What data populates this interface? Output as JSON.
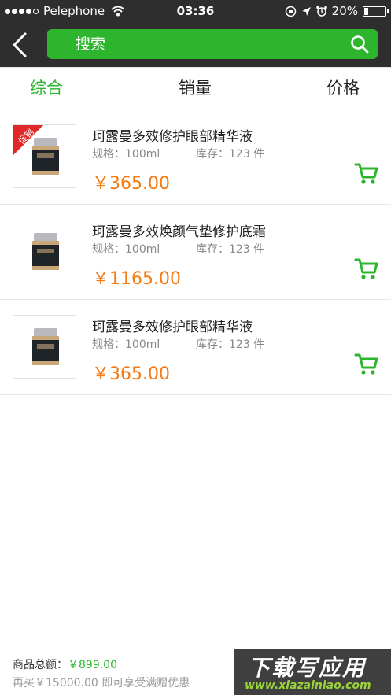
{
  "status_bar": {
    "carrier": "Pelephone",
    "time": "03:36",
    "battery_label": "20%",
    "battery_level": 0.2,
    "signal_bars": 4
  },
  "header": {
    "back_icon": "chevron-left-icon",
    "search_placeholder": "搜索",
    "search_icon": "search-icon"
  },
  "tabs": [
    {
      "label": "综合",
      "active": true
    },
    {
      "label": "销量",
      "active": false
    },
    {
      "label": "价格",
      "active": false
    }
  ],
  "products": [
    {
      "name": "珂露曼多效修护眼部精华液",
      "spec": "规格：100ml",
      "stock": "库存：123 件",
      "price": "￥365.00",
      "badge": "促销"
    },
    {
      "name": "珂露曼多效焕颜气垫修护底霜",
      "spec": "规格：100ml",
      "stock": "库存：123 件",
      "price": "￥1165.00"
    },
    {
      "name": "珂露曼多效修护眼部精华液",
      "spec": "规格：100ml",
      "stock": "库存：123 件",
      "price": "￥365.00"
    }
  ],
  "footer": {
    "total_label": "商品总额：",
    "total_amount": "￥899.00",
    "promo_hint": "再买￥15000.00 即可享受满赠优惠"
  },
  "watermark": {
    "title": "下载写应用",
    "url": "www.xiazainiao.com"
  },
  "colors": {
    "accent": "#2db52d",
    "price": "#f57a12",
    "bar": "#2e2e2e",
    "promo": "#e12828"
  }
}
